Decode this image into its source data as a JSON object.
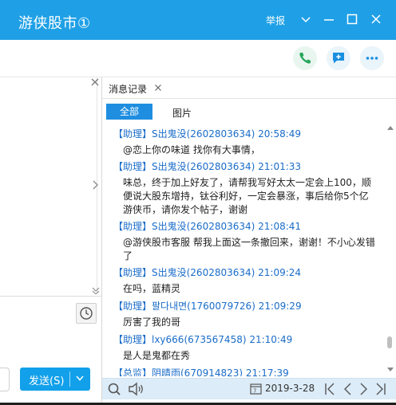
{
  "window": {
    "title": "游侠股市①",
    "report_label": "举报",
    "colors": {
      "titlebar": "#1fa0e6",
      "accent": "#1f8ee0",
      "link": "#1a6cc9"
    }
  },
  "toolbar": {
    "icons": [
      "phone-icon",
      "message-plus-icon",
      "more-icon"
    ]
  },
  "compose": {
    "send_label": "发送(S)"
  },
  "record_panel": {
    "tab_title": "消息记录",
    "filters": {
      "all": "全部",
      "images": "图片"
    },
    "messages": [
      {
        "head": "【助理】S出鬼没(2602803634) 20:58:49",
        "body": "@恋上你の味道 找你有大事情，"
      },
      {
        "head": "【助理】S出鬼没(2602803634) 21:01:33",
        "body": "味总，终于加上好友了，请帮我写好太太一定会上100，顺便说大股东增持，钛谷利好，一定会暴涨，事后给你5个亿游侠币，请你发个帖子，谢谢"
      },
      {
        "head": "【助理】S出鬼没(2602803634) 21:08:41",
        "body": "@游侠股市客服 帮我上面这一条撤回来，谢谢！不小心发错了"
      },
      {
        "head": "【助理】S出鬼没(2602803634) 21:09:24",
        "body": "在吗，蓝精灵"
      },
      {
        "head": "【助理】팔다내면(1760079726) 21:09:29",
        "body": "厉害了我的哥"
      },
      {
        "head": "【助理】lxy666(673567458) 21:10:49",
        "body": "是人是鬼都在秀"
      },
      {
        "head": "【总监】阴晴雨(670914823) 21:17:39",
        "body": ""
      }
    ],
    "status": {
      "date": "2019-3-28"
    }
  }
}
